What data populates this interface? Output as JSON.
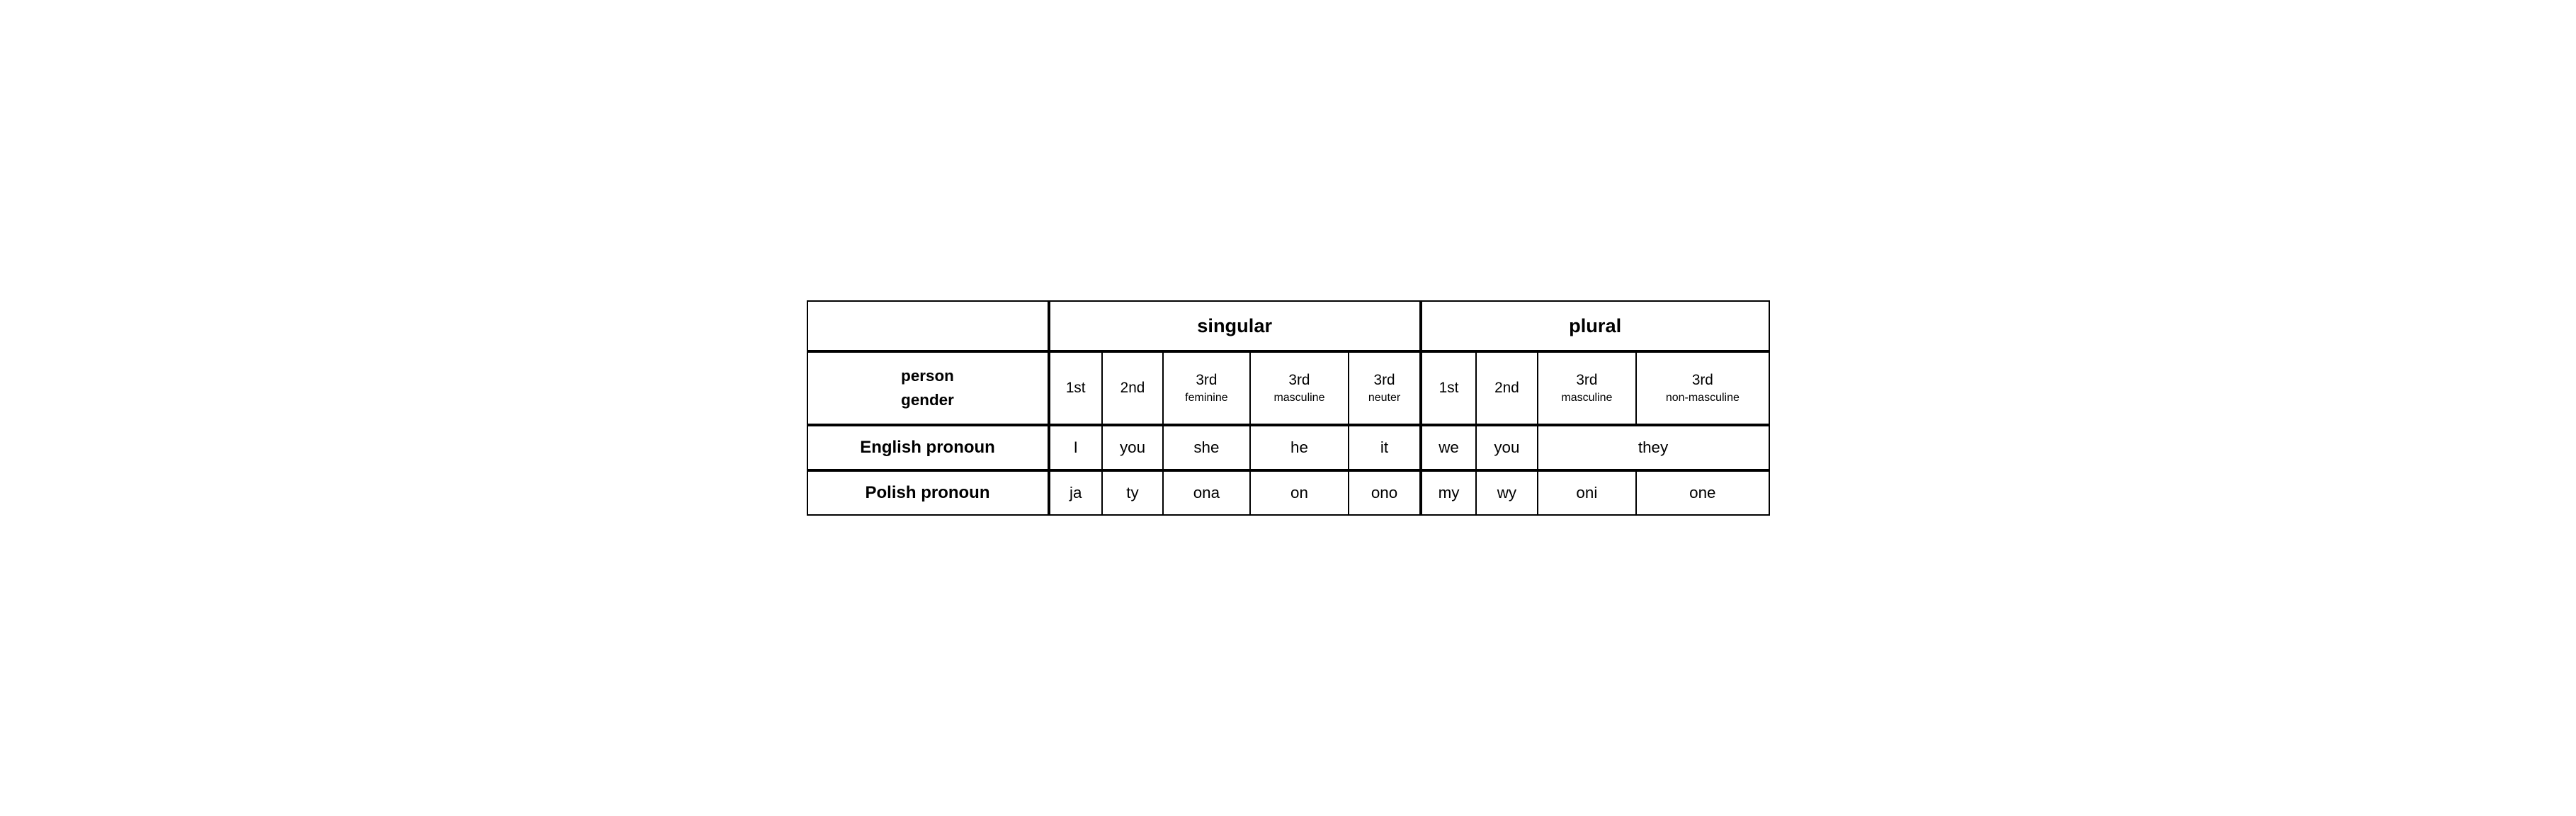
{
  "table": {
    "title_singular": "singular",
    "title_plural": "plural",
    "row_person_gender_label1": "person",
    "row_person_gender_label2": "gender",
    "columns": [
      {
        "main": "1st",
        "sub": ""
      },
      {
        "main": "2nd",
        "sub": ""
      },
      {
        "main": "3rd",
        "sub": "feminine"
      },
      {
        "main": "3rd",
        "sub": "masculine"
      },
      {
        "main": "3rd",
        "sub": "neuter"
      },
      {
        "main": "1st",
        "sub": ""
      },
      {
        "main": "2nd",
        "sub": ""
      },
      {
        "main": "3rd",
        "sub": "masculine"
      },
      {
        "main": "3rd",
        "sub": "non-masculine"
      }
    ],
    "rows": [
      {
        "header": "English pronoun",
        "cells": [
          "I",
          "you",
          "she",
          "he",
          "it",
          "we",
          "you",
          "they",
          null
        ]
      },
      {
        "header": "Polish pronoun",
        "cells": [
          "ja",
          "ty",
          "ona",
          "on",
          "ono",
          "my",
          "wy",
          "oni",
          "one"
        ]
      }
    ]
  }
}
